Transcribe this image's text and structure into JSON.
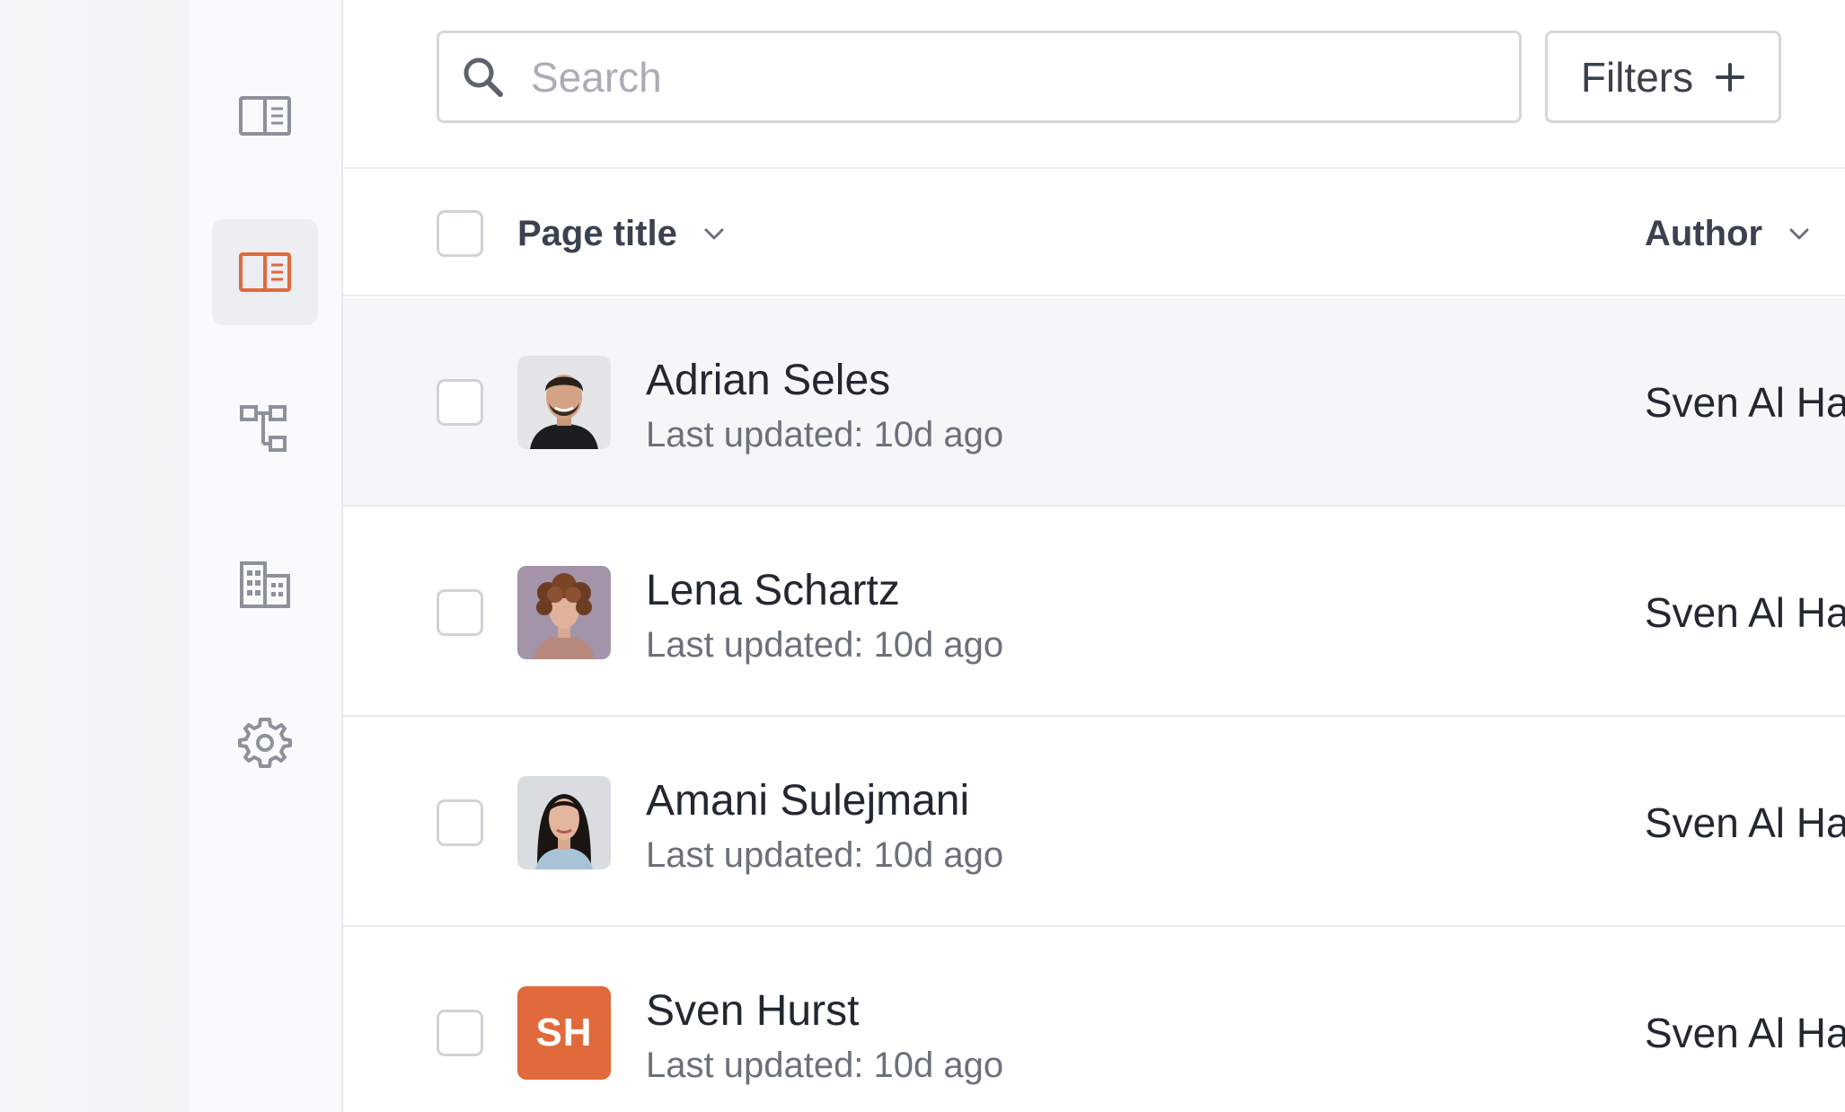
{
  "colors": {
    "accent": "#e06a3b",
    "border": "#d4d7dc",
    "row_hover": "#f5f6f8",
    "sidebar_bg": "#f9fafb"
  },
  "sidebar": {
    "items": [
      {
        "icon": "book-open-icon",
        "active": false
      },
      {
        "icon": "book-open-icon",
        "active": true
      },
      {
        "icon": "sitemap-icon",
        "active": false
      },
      {
        "icon": "building-icon",
        "active": false
      },
      {
        "icon": "gear-icon",
        "active": false
      }
    ]
  },
  "search": {
    "placeholder": "Search",
    "value": ""
  },
  "filters": {
    "label": "Filters"
  },
  "table": {
    "columns": [
      {
        "label": "Page title"
      },
      {
        "label": "Author"
      }
    ],
    "rows": [
      {
        "title": "Adrian Seles",
        "updated": "Last updated: 10d ago",
        "author": "Sven Al Ha",
        "avatar": "photo-man-beard"
      },
      {
        "title": "Lena Schartz",
        "updated": "Last updated: 10d ago",
        "author": "Sven Al Ha",
        "avatar": "photo-curly-hair"
      },
      {
        "title": "Amani Sulejmani",
        "updated": "Last updated: 10d ago",
        "author": "Sven Al Ha",
        "avatar": "photo-woman-dark-hair"
      },
      {
        "title": "Sven Hurst",
        "updated": "Last updated: 10d ago",
        "author": "Sven Al Ha",
        "avatar": "initials",
        "initials": "SH"
      }
    ]
  }
}
